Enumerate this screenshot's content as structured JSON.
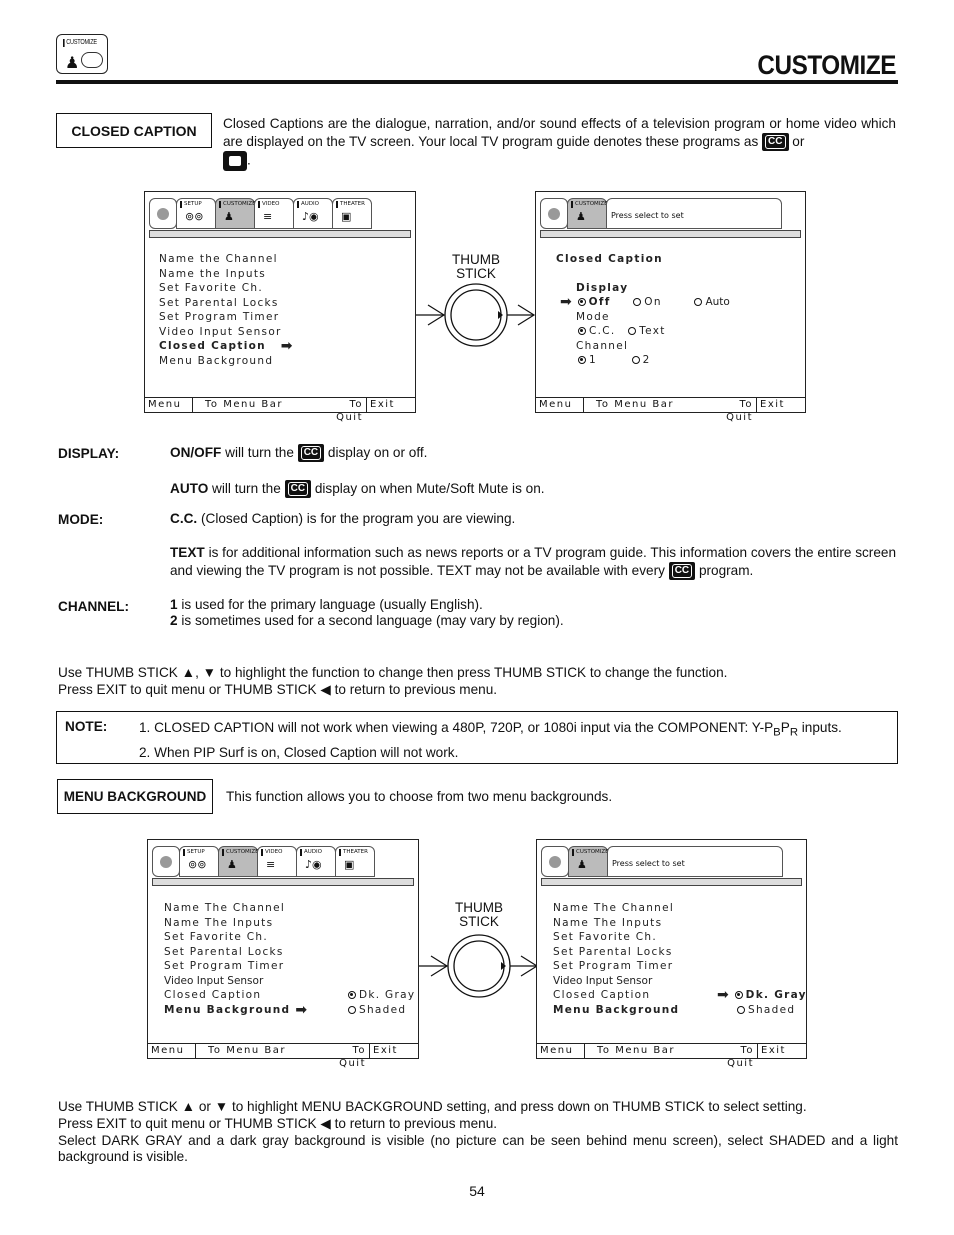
{
  "header": {
    "icon_label": "CUSTOMIZE",
    "title": "CUSTOMIZE"
  },
  "closed_caption": {
    "label": "CLOSED CAPTION",
    "description": "Closed Captions are the dialogue, narration, and/or sound effects of a television program or home video which are displayed on the TV screen.  Your local TV program guide denotes these programs as",
    "or_text": "or",
    "cc_symbol": "CC"
  },
  "tv_menu_tabs": [
    "SETUP",
    "CUSTOMIZE",
    "VIDEO",
    "AUDIO",
    "THEATER"
  ],
  "tv_footer": {
    "menu": "Menu",
    "to_menu_bar": "To Menu Bar",
    "to_quit": "To Quit",
    "exit": "Exit"
  },
  "press_select": "Press select to set",
  "thumb_stick": {
    "line1": "THUMB",
    "line2": "STICK"
  },
  "screen1": {
    "items": [
      "Name the Channel",
      "Name the Inputs",
      "Set Favorite Ch.",
      "Set Parental Locks",
      "Set Program Timer",
      "Video Input Sensor",
      "Closed Caption",
      "Menu Background"
    ],
    "selected": "Closed Caption"
  },
  "screen2": {
    "title": "Closed Caption",
    "display_label": "Display",
    "display_options": [
      "Off",
      "On",
      "Auto"
    ],
    "display_selected": "Off",
    "mode_label": "Mode",
    "mode_options": [
      "C.C.",
      "Text"
    ],
    "mode_selected": "C.C.",
    "channel_label": "Channel",
    "channel_options": [
      "1",
      "2"
    ],
    "channel_selected": "1"
  },
  "definitions": {
    "display_label": "DISPLAY:",
    "onoff_bold": "ON/OFF",
    "onoff_pre": "will turn the",
    "onoff_post": "display on or off.",
    "auto_bold": "AUTO",
    "auto_pre": "will turn the",
    "auto_post": "display on when Mute/Soft Mute is on.",
    "mode_label": "MODE:",
    "cc_bold": "C.C.",
    "cc_text": "(Closed Caption) is for the program you are viewing.",
    "text_bold": "TEXT",
    "text_text": "is for additional information such as news reports or a TV program guide.  This information covers the entire screen and viewing the TV program is not possible.  TEXT may not be available with every",
    "text_post": "program.",
    "channel_label": "CHANNEL:",
    "ch1_bold": "1",
    "ch1_text": "is used for the primary language (usually English).",
    "ch2_bold": "2",
    "ch2_text": "is sometimes used for a second language (may vary by region)."
  },
  "instructions1": {
    "line1": "Use THUMB STICK ▲, ▼ to highlight the function to change then press THUMB STICK to change the function.",
    "line2": "Press EXIT to quit menu or THUMB STICK ◀ to return to previous menu."
  },
  "note": {
    "label": "NOTE:",
    "item1_pre": "1.  CLOSED CAPTION will not work when viewing a 480P, 720P, or 1080i input via the COMPONENT: Y-P",
    "item1_sub1": "B",
    "item1_mid": "P",
    "item1_sub2": "R",
    "item1_post": " inputs.",
    "item2": "2.  When PIP Surf is on, Closed Caption will not work."
  },
  "menu_background": {
    "label": "MENU BACKGROUND",
    "description": "This function allows you to choose from two menu backgrounds."
  },
  "screen3": {
    "items": [
      "Name The Channel",
      "Name The Inputs",
      "Set Favorite Ch.",
      "Set Parental Locks",
      "Set Program Timer",
      "Video Input Sensor",
      "Closed Caption",
      "Menu Background"
    ],
    "options": [
      "Dk. Gray",
      "Shaded"
    ],
    "selected_option": "Dk. Gray"
  },
  "instructions2": {
    "line1": "Use THUMB STICK ▲ or ▼ to highlight MENU BACKGROUND setting, and press down on THUMB STICK  to select setting.",
    "line2": "Press EXIT to quit menu or THUMB STICK ◀ to return to previous menu.",
    "line3": "Select DARK GRAY and a dark gray background is visible (no picture can be seen behind menu screen), select SHADED and a light background is visible."
  },
  "page_number": "54"
}
